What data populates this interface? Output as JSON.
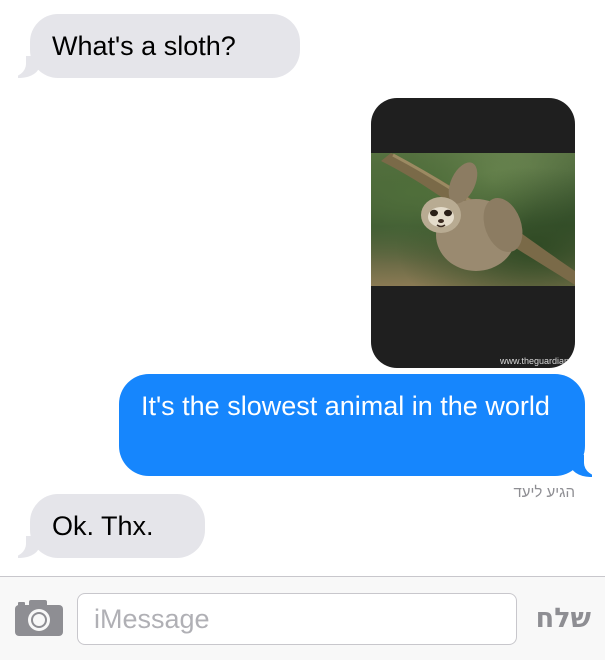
{
  "conversation": {
    "messages": [
      {
        "direction": "incoming",
        "text": "What's a sloth?"
      },
      {
        "direction": "outgoing",
        "type": "image",
        "source_credit": "www.theguardian"
      },
      {
        "direction": "outgoing",
        "text": "It's the slowest animal in the world"
      },
      {
        "direction": "incoming",
        "text": "Ok. Thx."
      }
    ],
    "delivery_status": "הגיע ליעד"
  },
  "compose": {
    "placeholder": "iMessage",
    "value": "",
    "send_label": "שלח",
    "camera_icon": "camera-icon"
  },
  "colors": {
    "incoming_bubble": "#e5e5ea",
    "outgoing_bubble": "#1686fd",
    "image_bubble": "#1f1f1f",
    "status_text": "#8e8e93"
  }
}
